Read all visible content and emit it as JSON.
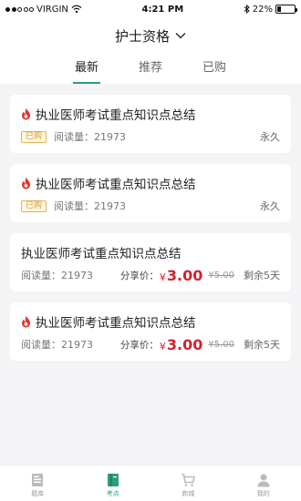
{
  "status": {
    "carrier": "VIRGIN",
    "time": "4:21 PM",
    "battery": "22%",
    "battery_level": 0.22
  },
  "header": {
    "title": "护士资格"
  },
  "tabs": [
    {
      "label": "最新",
      "active": true
    },
    {
      "label": "推荐",
      "active": false
    },
    {
      "label": "已购",
      "active": false
    }
  ],
  "cards": [
    {
      "title": "执业医师考试重点知识点总结",
      "badge": "已购",
      "reads": "阅读量：21973",
      "right": "永久"
    },
    {
      "title": "执业医师考试重点知识点总结",
      "badge": "已购",
      "reads": "阅读量：21973",
      "right": "永久"
    },
    {
      "title": "执业医师考试重点知识点总结",
      "reads": "阅读量：21973",
      "share_label": "分享价：",
      "currency": "¥",
      "price": "3.00",
      "old_price": "¥5.00",
      "right": "剩余5天"
    },
    {
      "title": "执业医师考试重点知识点总结",
      "reads": "阅读量：21973",
      "share_label": "分享价：",
      "currency": "¥",
      "price": "3.00",
      "old_price": "¥5.00",
      "right": "剩余5天"
    }
  ],
  "tabbar": [
    {
      "label": "题库",
      "icon": "question-bank-icon"
    },
    {
      "label": "考点",
      "icon": "book-icon",
      "active": true
    },
    {
      "label": "商城",
      "icon": "cart-icon"
    },
    {
      "label": "我的",
      "icon": "person-icon"
    }
  ],
  "colors": {
    "accent": "#2a9d7f",
    "price": "#d3212e",
    "badge": "#d39b2e"
  }
}
